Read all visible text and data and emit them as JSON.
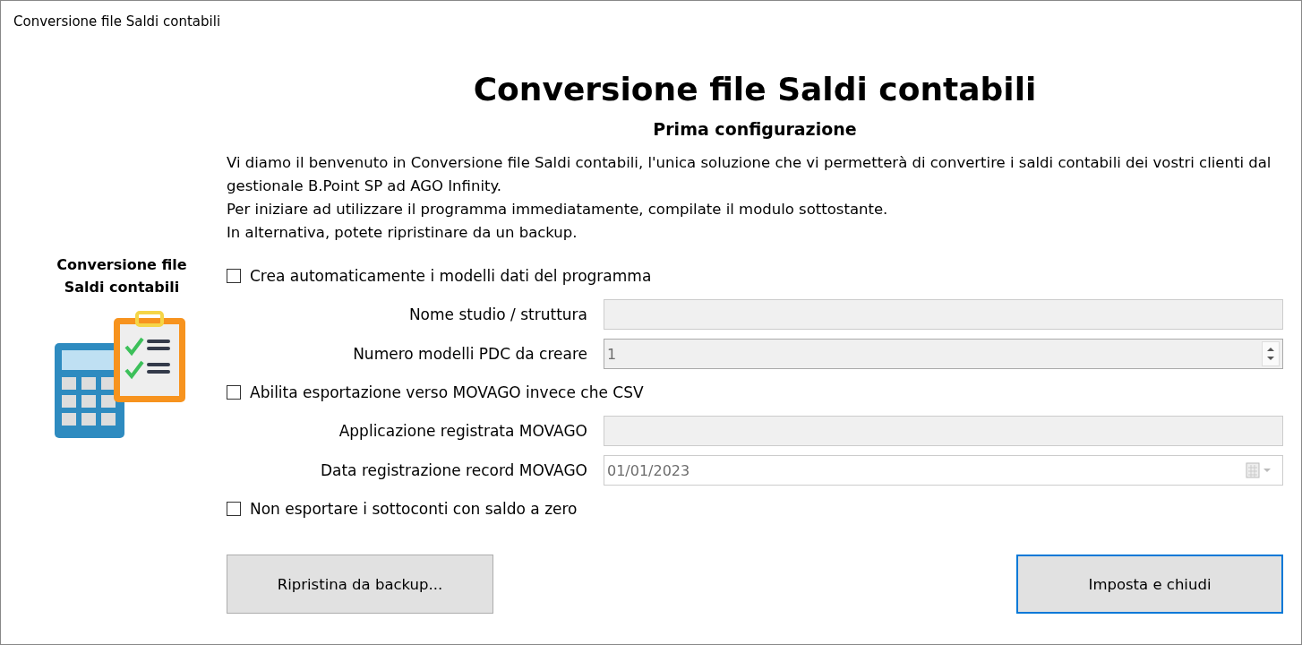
{
  "window": {
    "title": "Conversione file Saldi contabili"
  },
  "logo": {
    "caption": "Conversione file Saldi contabili"
  },
  "heading": "Conversione file Saldi contabili",
  "subheading": "Prima configurazione",
  "intro": [
    "Vi diamo il benvenuto in Conversione file Saldi contabili, l'unica soluzione che vi permetterà di convertire i saldi contabili dei vostri clienti dal gestionale B.Point SP ad AGO Infinity.",
    "Per iniziare ad utilizzare il programma immediatamente, compilate il modulo sottostante.",
    "In alternativa, potete ripristinare da un backup."
  ],
  "form": [
    {
      "kind": "checkbox",
      "label": "Crea automaticamente i modelli dati del programma",
      "checked": false
    },
    {
      "kind": "text",
      "label": "Nome studio / struttura"
    },
    {
      "kind": "spin",
      "label": "Numero modelli PDC da creare",
      "value": "1"
    },
    {
      "kind": "checkbox",
      "label": "Abilita esportazione verso MOVAGO invece che CSV",
      "checked": false
    },
    {
      "kind": "text",
      "label": "Applicazione registrata MOVAGO"
    },
    {
      "kind": "date",
      "label": "Data registrazione record MOVAGO",
      "value": "01/01/2023"
    },
    {
      "kind": "checkbox",
      "label": "Non esportare i sottoconti con saldo a zero",
      "checked": false
    }
  ],
  "buttons": [
    {
      "label": "Ripristina da backup...",
      "default": false
    },
    {
      "label": "Imposta e chiudi",
      "default": true
    }
  ]
}
